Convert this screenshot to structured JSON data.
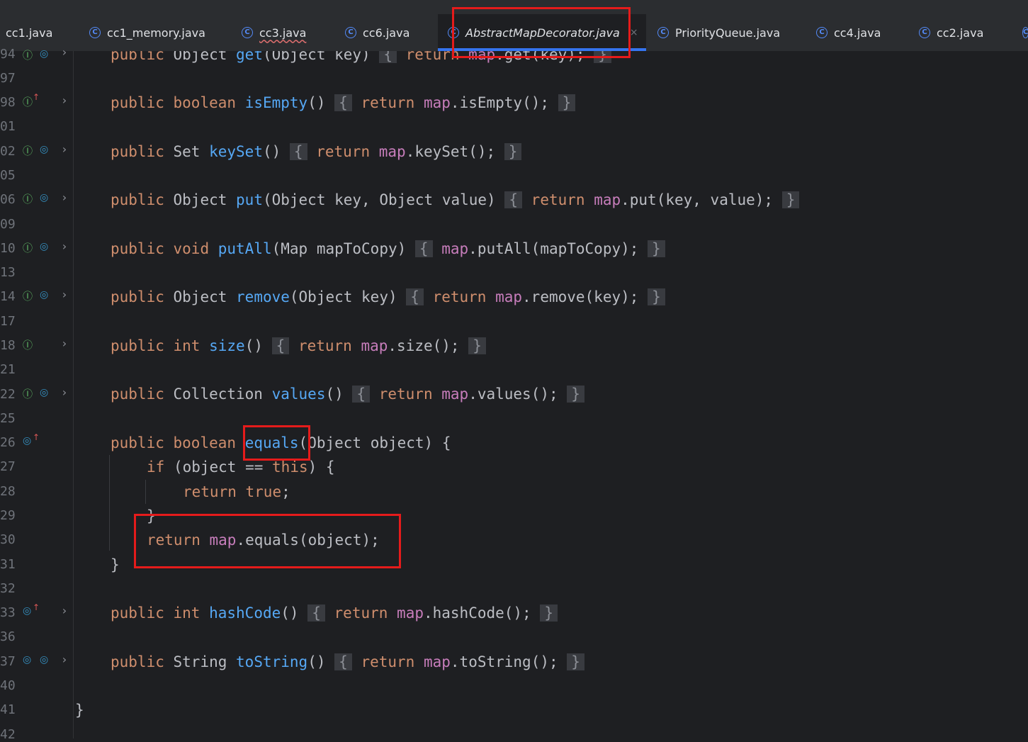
{
  "tabs": [
    {
      "label": "cc1.java",
      "icon": "class-icon"
    },
    {
      "label": "cc1_memory.java",
      "icon": "class-icon"
    },
    {
      "label": "cc3.java",
      "icon": "class-icon",
      "error": true
    },
    {
      "label": "cc6.java",
      "icon": "class-icon"
    },
    {
      "label": "AbstractMapDecorator.java",
      "icon": "class-icon",
      "active": true,
      "close": "×"
    },
    {
      "label": "PriorityQueue.java",
      "icon": "class-icon"
    },
    {
      "label": "cc4.java",
      "icon": "class-icon"
    },
    {
      "label": "cc2.java",
      "icon": "class-icon"
    }
  ],
  "line_numbers": [
    "94",
    "97",
    "98",
    "01",
    "02",
    "05",
    "06",
    "09",
    "10",
    "13",
    "14",
    "17",
    "18",
    "21",
    "22",
    "25",
    "26",
    "27",
    "28",
    "29",
    "30",
    "31",
    "32",
    "33",
    "36",
    "37",
    "40",
    "41",
    "42"
  ],
  "code": {
    "get": {
      "kw": "public",
      "type": "Object",
      "name": "get",
      "params": "(Object key)",
      "body_kw": "return",
      "body_field": "map",
      "body_rest": ".get(key);"
    },
    "isEmpty": {
      "kw": "public",
      "type": "boolean",
      "name": "isEmpty",
      "params": "()",
      "body_kw": "return",
      "body_field": "map",
      "body_rest": ".isEmpty();"
    },
    "keySet": {
      "kw": "public",
      "type": "Set",
      "name": "keySet",
      "params": "()",
      "body_kw": "return",
      "body_field": "map",
      "body_rest": ".keySet();"
    },
    "put": {
      "kw": "public",
      "type": "Object",
      "name": "put",
      "params": "(Object key, Object value)",
      "body_kw": "return",
      "body_field": "map",
      "body_rest": ".put(key, value);"
    },
    "putAll": {
      "kw": "public",
      "type": "void",
      "name": "putAll",
      "params": "(Map mapToCopy)",
      "body_field": "map",
      "body_rest": ".putAll(mapToCopy);"
    },
    "remove": {
      "kw": "public",
      "type": "Object",
      "name": "remove",
      "params": "(Object key)",
      "body_kw": "return",
      "body_field": "map",
      "body_rest": ".remove(key);"
    },
    "size": {
      "kw": "public",
      "type": "int",
      "name": "size",
      "params": "()",
      "body_kw": "return",
      "body_field": "map",
      "body_rest": ".size();"
    },
    "values": {
      "kw": "public",
      "type": "Collection",
      "name": "values",
      "params": "()",
      "body_kw": "return",
      "body_field": "map",
      "body_rest": ".values();"
    },
    "equals": {
      "kw": "public",
      "type": "boolean",
      "name": "equals",
      "params_rest": "(Object object) {",
      "if_kw": "if",
      "if_cond_a": "(object == ",
      "this_kw": "this",
      "if_cond_b": ") {",
      "ret_kw": "return",
      "true_kw": "true",
      ";": ";",
      "close_inner": "}",
      "ret2_kw": "return",
      "ret2_field": "map",
      "ret2_rest": ".equals(object);",
      "close_outer": "}"
    },
    "hashCode": {
      "kw": "public",
      "type": "int",
      "name": "hashCode",
      "params": "()",
      "body_kw": "return",
      "body_field": "map",
      "body_rest": ".hashCode();"
    },
    "toString": {
      "kw": "public",
      "type": "String",
      "name": "toString",
      "params": "()",
      "body_kw": "return",
      "body_field": "map",
      "body_rest": ".toString();"
    },
    "class_close": "}",
    "fold_open": "{",
    "fold_close": "}"
  },
  "colors": {
    "highlight": "#e51b1b",
    "keyword": "#cf8e6d",
    "method": "#56a8f5",
    "field": "#c77dbb",
    "tab_underline": "#3574f0"
  }
}
